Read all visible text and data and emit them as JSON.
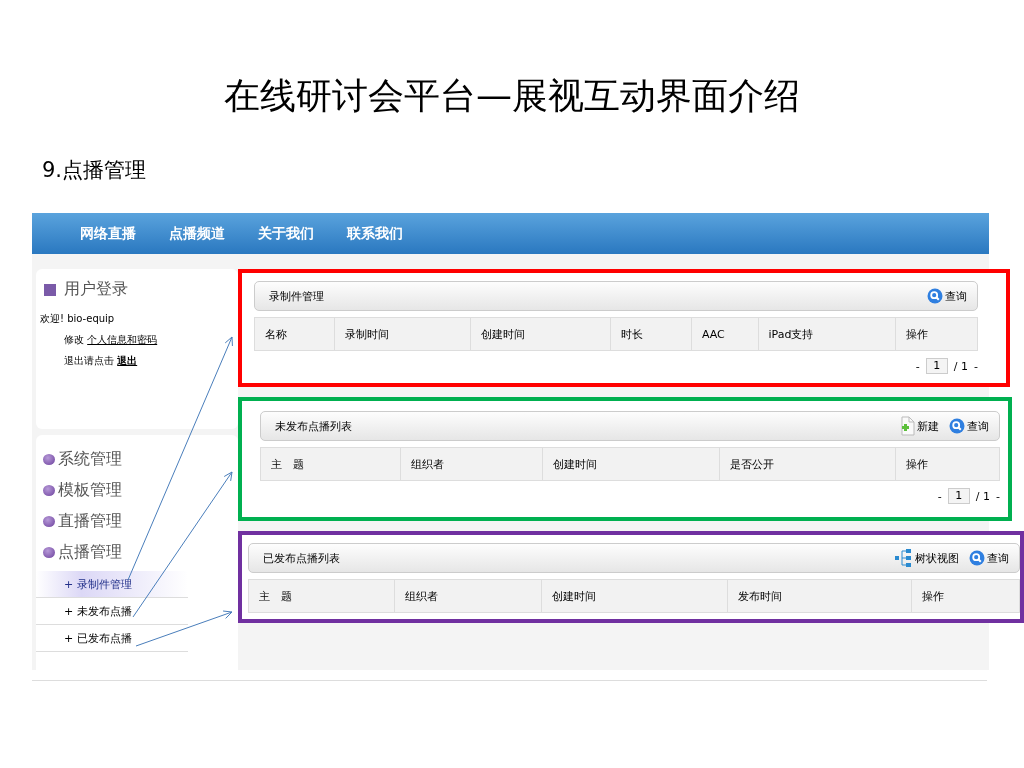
{
  "slide": {
    "title": "在线研讨会平台—展视互动界面介绍",
    "subtitle": "9.点播管理"
  },
  "nav": {
    "items": [
      "网络直播",
      "点播频道",
      "关于我们",
      "联系我们"
    ]
  },
  "login": {
    "title": "用户登录",
    "welcome": "欢迎! bio-equip",
    "edit_label": "修改",
    "edit_link": "个人信息和密码",
    "logout_label": "退出请点击",
    "logout_link": "退出"
  },
  "menu": [
    {
      "label": "系统管理"
    },
    {
      "label": "模板管理"
    },
    {
      "label": "直播管理"
    },
    {
      "label": "点播管理",
      "children": [
        {
          "label": "+ 录制件管理",
          "selected": true
        },
        {
          "label": "+ 未发布点播",
          "selected": false
        },
        {
          "label": "+ 已发布点播",
          "selected": false
        }
      ]
    }
  ],
  "panels": [
    {
      "title": "录制件管理",
      "color": "#ff0000",
      "actions": [
        {
          "kind": "search",
          "label": "查询"
        }
      ],
      "columns": [
        "名称",
        "录制时间",
        "创建时间",
        "时长",
        "AAC",
        "iPad支持",
        "操作"
      ],
      "pager": {
        "prev": "-",
        "current": "1",
        "total": "/ 1",
        "next": "-"
      }
    },
    {
      "title": "未发布点播列表",
      "color": "#00b050",
      "actions": [
        {
          "kind": "new",
          "label": "新建"
        },
        {
          "kind": "search",
          "label": "查询"
        }
      ],
      "columns": [
        "主　题",
        "组织者",
        "创建时间",
        "是否公开",
        "操作"
      ],
      "pager": {
        "prev": "-",
        "current": "1",
        "total": "/ 1",
        "next": "-"
      }
    },
    {
      "title": "已发布点播列表",
      "color": "#7030a0",
      "actions": [
        {
          "kind": "tree",
          "label": "树状视图"
        },
        {
          "kind": "search",
          "label": "查询"
        }
      ],
      "columns": [
        "主　题",
        "组织者",
        "创建时间",
        "发布时间",
        "操作"
      ]
    }
  ]
}
